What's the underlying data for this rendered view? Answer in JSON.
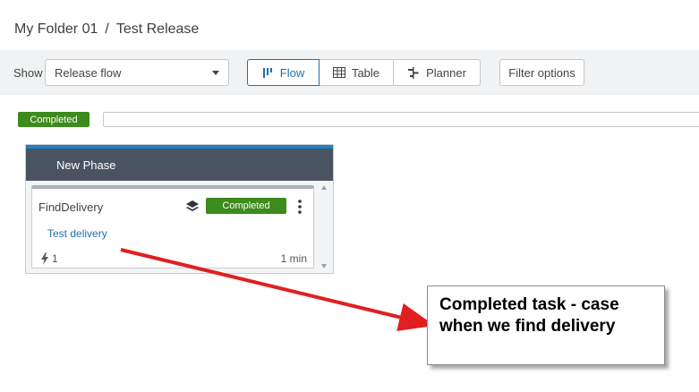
{
  "breadcrumb": {
    "folder": "My Folder 01",
    "separator": "/",
    "release": "Test Release"
  },
  "toolbar": {
    "show_label": "Show",
    "view_select": {
      "value": "Release flow"
    },
    "views": [
      {
        "label": "Flow",
        "icon": "flow-icon",
        "active": true
      },
      {
        "label": "Table",
        "icon": "table-icon",
        "active": false
      },
      {
        "label": "Planner",
        "icon": "planner-icon",
        "active": false
      }
    ],
    "filter_label": "Filter options"
  },
  "release_status": "Completed",
  "phase": {
    "name": "New Phase",
    "task": {
      "title": "FindDelivery",
      "status": "Completed",
      "link": "Test delivery",
      "count": "1",
      "duration": "1 min"
    }
  },
  "annotation": {
    "line1": "Completed task - case",
    "line2": "when we find delivery"
  },
  "colors": {
    "completed": "#3d8a1d",
    "accent": "#1f6fa8",
    "phase_header": "#4a5461",
    "annotation_arrow": "#e02020"
  }
}
